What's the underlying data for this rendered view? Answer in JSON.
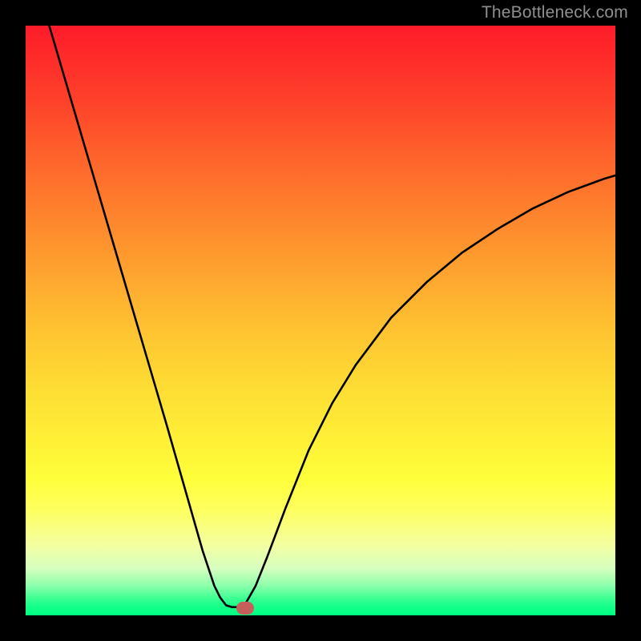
{
  "watermark": "TheBottleneck.com",
  "chart_data": {
    "type": "line",
    "title": "",
    "xlabel": "",
    "ylabel": "",
    "xlim": [
      0,
      100
    ],
    "ylim": [
      0,
      100
    ],
    "grid": false,
    "legend": false,
    "series": [
      {
        "name": "left-branch",
        "x": [
          4,
          6,
          8,
          10,
          12,
          14,
          16,
          18,
          20,
          22,
          24,
          26,
          28,
          30,
          31,
          32,
          33,
          34
        ],
        "y": [
          100,
          93.2,
          86.4,
          79.6,
          72.8,
          66.0,
          59.2,
          52.4,
          45.6,
          38.8,
          32.0,
          25.0,
          18.0,
          11.0,
          8.0,
          5.0,
          3.0,
          1.7
        ]
      },
      {
        "name": "bottom-flat",
        "x": [
          34,
          35,
          36,
          37
        ],
        "y": [
          1.7,
          1.4,
          1.4,
          1.5
        ]
      },
      {
        "name": "right-branch",
        "x": [
          37,
          39,
          41,
          44,
          48,
          52,
          56,
          62,
          68,
          74,
          80,
          86,
          92,
          98,
          100
        ],
        "y": [
          1.5,
          5.0,
          10.0,
          18.0,
          28.0,
          36.0,
          42.5,
          50.5,
          56.5,
          61.5,
          65.5,
          69.0,
          71.8,
          74.0,
          74.6
        ]
      }
    ],
    "marker": {
      "x": 37.2,
      "y": 1.2,
      "color": "#c65f5c"
    },
    "background_gradient": {
      "top": "#fe1b2a",
      "mid": "#fede34",
      "bottom": "#00ff84"
    },
    "curve_color": "#000000"
  }
}
